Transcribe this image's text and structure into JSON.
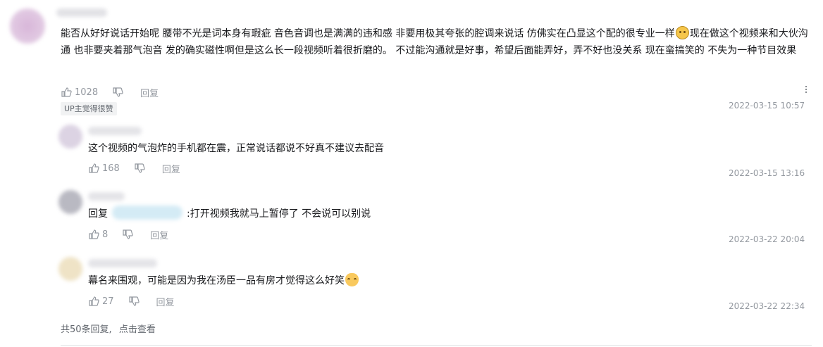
{
  "main_comment": {
    "text_parts": [
      "能否从好好说话开始呢 腰带不光是词本身有瑕疵 音色音调也是满满的违和感 非要用极其夸张的腔调来说话 仿佛实在凸显这个配的很专业一样",
      "现在做这个视频来和大伙沟通 也非要夹着那气泡音 发的确实磁性啊但是这么长一段视频听着很折磨的。 不过能沟通就是好事，希望后面能弄好，弄不好也没关系 现在蛮搞笑的 不失为一种节目效果"
    ],
    "likes": "1028",
    "reply_label": "回复",
    "badge": "UP主觉得很赞",
    "time": "2022-03-15 10:57"
  },
  "replies": [
    {
      "text": "这个视频的气泡炸的手机都在震，正常说话都说不好真不建议去配音",
      "likes": "168",
      "reply_label": "回复",
      "time": "2022-03-15 13:16"
    },
    {
      "prefix": "回复",
      "text": ":打开视频我就马上暂停了 不会说可以别说",
      "likes": "8",
      "reply_label": "回复",
      "time": "2022-03-22 20:04"
    },
    {
      "text": "幕名来围观，可能是因为我在汤臣一品有房才觉得这么好笑",
      "likes": "27",
      "reply_label": "回复",
      "time": "2022-03-22 22:34"
    }
  ],
  "footer": {
    "count_text": "共50条回复,",
    "view_text": "点击查看"
  },
  "icons": [
    "thumbs-up-icon",
    "thumbs-down-icon",
    "more-icon",
    "sad-emoji-icon",
    "cat-emoji-icon"
  ]
}
